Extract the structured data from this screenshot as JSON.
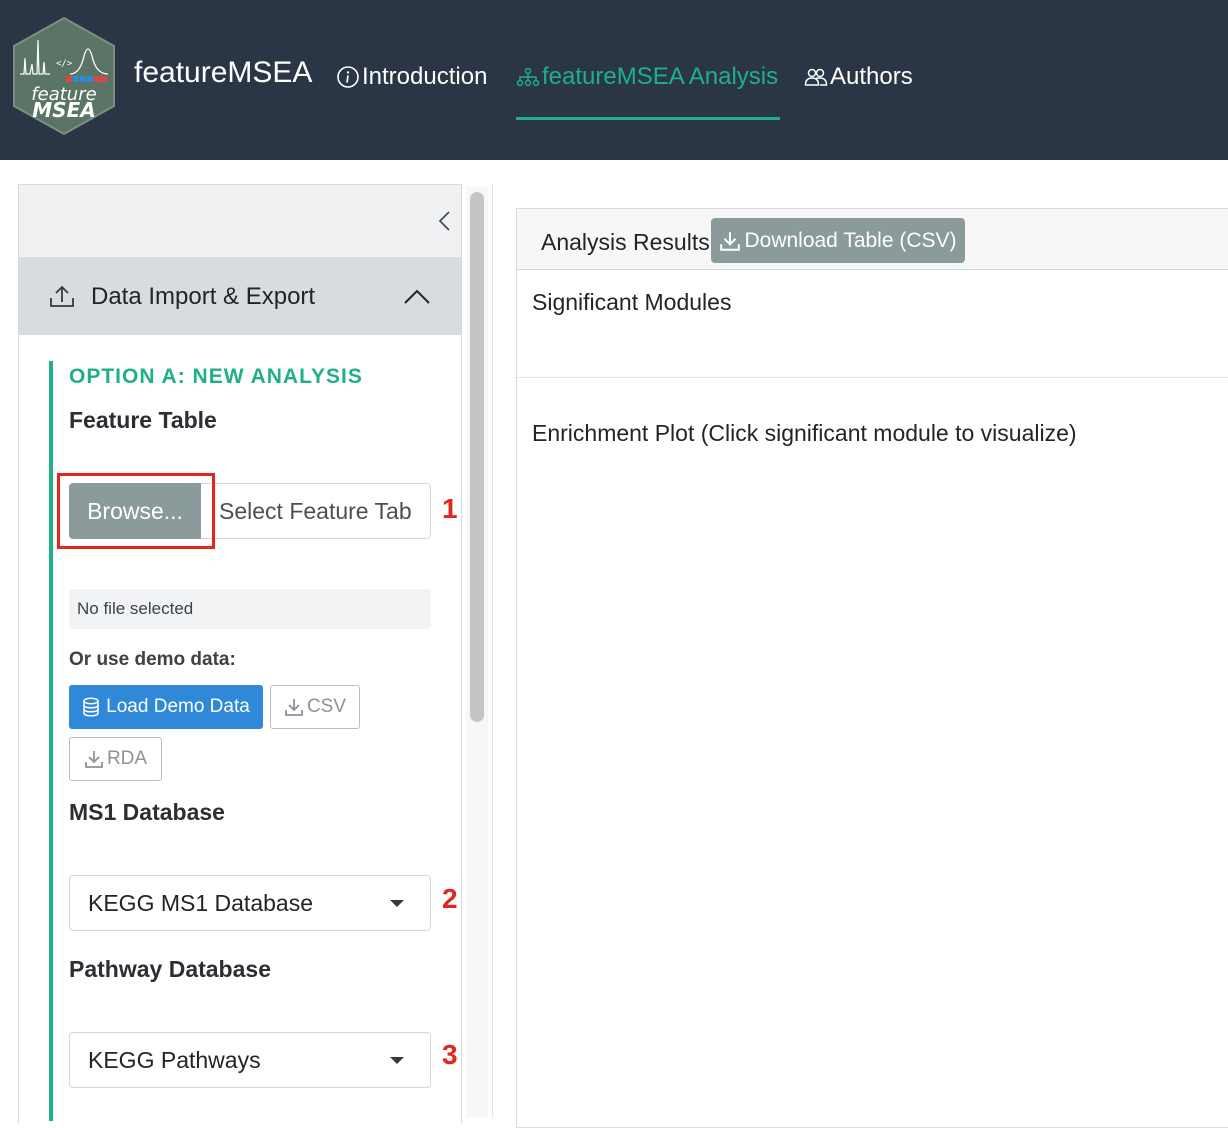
{
  "navbar": {
    "logo_text_1": "feature",
    "logo_text_2": "MSEA",
    "brand": "featureMSEA",
    "tabs": [
      {
        "label": "Introduction",
        "icon": "info-circle-icon",
        "active": false
      },
      {
        "label": "featureMSEA Analysis",
        "icon": "network-diagram-icon",
        "active": true
      },
      {
        "label": "Authors",
        "icon": "people-icon",
        "active": false
      }
    ],
    "bg_color": "#2a3546",
    "accent_color": "#1fb08a"
  },
  "sidebar": {
    "accordion_title": "Data Import & Export",
    "option_a_label": "OPTION A: NEW ANALYSIS",
    "feature_table": {
      "label": "Feature Table",
      "browse_label": "Browse...",
      "file_placeholder": "Select Feature Tab",
      "status": "No file selected"
    },
    "demo": {
      "label": "Or use demo data:",
      "load_label": "Load Demo Data",
      "csv_label": "CSV",
      "rda_label": "RDA"
    },
    "ms1_database": {
      "label": "MS1 Database",
      "selected": "KEGG MS1 Database"
    },
    "pathway_database": {
      "label": "Pathway Database",
      "selected": "KEGG Pathways"
    },
    "steps": [
      "1",
      "2",
      "3"
    ]
  },
  "main": {
    "results_title": "Analysis Results",
    "download_label": "Download Table (CSV)",
    "significant_modules": "Significant Modules",
    "enrichment_plot": "Enrichment Plot (Click significant module to visualize)"
  }
}
